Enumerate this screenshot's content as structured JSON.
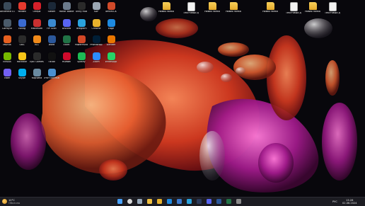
{
  "desktop": {
    "icons": [
      {
        "label": "Battlefield 4 ATM",
        "kind": "app",
        "color": "#3a4a5a"
      },
      {
        "label": "Yandex",
        "kind": "app",
        "color": "#e63a2e"
      },
      {
        "label": "Опера",
        "kind": "app",
        "color": "#d6202a"
      },
      {
        "label": "Steam",
        "kind": "app",
        "color": "#1b2838"
      },
      {
        "label": "Honor Battle",
        "kind": "app",
        "color": "#6b7a8c"
      },
      {
        "label": "Unity Hub",
        "kind": "app",
        "color": "#2a2a2a"
      },
      {
        "label": "SAP",
        "kind": "app",
        "color": "#9aa6b2"
      },
      {
        "label": "officeSCK",
        "kind": "app",
        "color": "#d04a2a"
      },
      {
        "label": "Новая папка",
        "kind": "folder"
      },
      {
        "label": "Текстовый документ",
        "kind": "doc"
      },
      {
        "label": "Новая папка",
        "kind": "folder"
      },
      {
        "label": "Новая папка",
        "kind": "folder"
      },
      {
        "label": "Новая папка",
        "kind": "folder"
      },
      {
        "label": "Текстовый документ",
        "kind": "doc"
      },
      {
        "label": "Новая папка",
        "kind": "folder"
      },
      {
        "label": "Текстовый документ",
        "kind": "doc"
      },
      {
        "label": "ComfyUI",
        "kind": "app",
        "color": "#4a5a6a"
      },
      {
        "label": "config",
        "kind": "app",
        "color": "#3a6ad0"
      },
      {
        "label": "Maximum",
        "kind": "app",
        "color": "#c83030"
      },
      {
        "label": "HP Scan",
        "kind": "app",
        "color": "#3a8ad0"
      },
      {
        "label": "Discord",
        "kind": "app",
        "color": "#5865f2"
      },
      {
        "label": "Telegram",
        "kind": "app",
        "color": "#2aa3dd"
      },
      {
        "label": "Chrome",
        "kind": "app",
        "color": "#e8b22c"
      },
      {
        "label": "Edge",
        "kind": "app",
        "color": "#1e8ae0"
      },
      {
        "label": "Mozilla",
        "kind": "app",
        "color": "#e66020"
      },
      {
        "label": "OBS",
        "kind": "app",
        "color": "#2a2a2a"
      },
      {
        "label": "VLC",
        "kind": "app",
        "color": "#f08a1a"
      },
      {
        "label": "Word",
        "kind": "app",
        "color": "#2b579a"
      },
      {
        "label": "Excel",
        "kind": "app",
        "color": "#217346"
      },
      {
        "label": "PowerPoint",
        "kind": "app",
        "color": "#d24726"
      },
      {
        "label": "Photoshop",
        "kind": "app",
        "color": "#001e36"
      },
      {
        "label": "Blender",
        "kind": "app",
        "color": "#ea7600"
      },
      {
        "label": "NVIDIA",
        "kind": "app",
        "color": "#76b900"
      },
      {
        "label": "Rockstar",
        "kind": "app",
        "color": "#f5c518"
      },
      {
        "label": "Epic Games",
        "kind": "app",
        "color": "#2a2a2a"
      },
      {
        "label": "TikTok",
        "kind": "app",
        "color": "#111111"
      },
      {
        "label": "Huawei",
        "kind": "app",
        "color": "#cf0a2c"
      },
      {
        "label": "Spotify",
        "kind": "app",
        "color": "#1db954"
      },
      {
        "label": "Zoom",
        "kind": "app",
        "color": "#2d8cff"
      },
      {
        "label": "WhatsApp",
        "kind": "app",
        "color": "#25d366"
      },
      {
        "label": "Viber",
        "kind": "app",
        "color": "#7360f2"
      },
      {
        "label": "Skype",
        "kind": "app",
        "color": "#00aff0"
      },
      {
        "label": "Корзина",
        "kind": "app",
        "color": "#6a8aa0"
      },
      {
        "label": "Этот компьютер",
        "kind": "app",
        "color": "#4a90d0"
      }
    ]
  },
  "taskbar": {
    "weather_temp": "10°C",
    "weather_desc": "Облачно",
    "search_placeholder": "Поиск",
    "lang": "РУС",
    "time": "13:28",
    "date": "02.06.2024",
    "apps": [
      "start",
      "search",
      "task-view",
      "explorer",
      "chrome",
      "edge",
      "store",
      "telegram",
      "steam",
      "discord",
      "word",
      "excel",
      "settings"
    ],
    "colors": {
      "bar": "#1c1c22",
      "accent": "#4aa3ff"
    }
  }
}
